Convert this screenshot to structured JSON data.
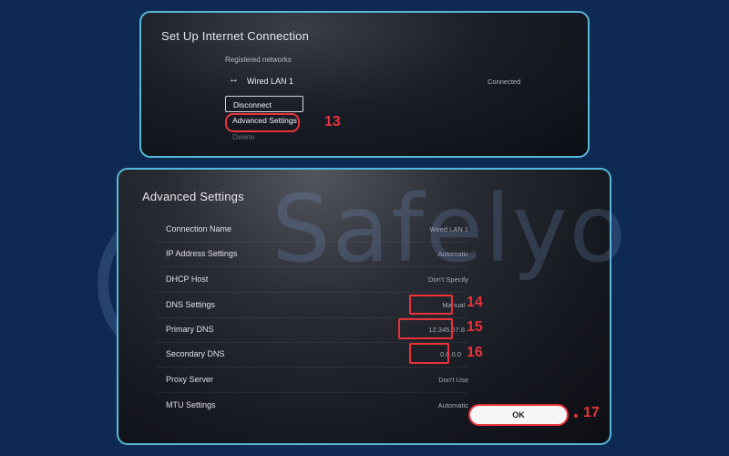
{
  "top_panel": {
    "title": "Set Up Internet Connection",
    "section_label": "Registered networks",
    "network": {
      "name": "Wired LAN 1",
      "status": "Connected"
    },
    "menu": [
      {
        "label": "Disconnect"
      },
      {
        "label": "Advanced Settings"
      },
      {
        "label": "Delete"
      }
    ],
    "step": "13"
  },
  "bottom_panel": {
    "title": "Advanced Settings",
    "rows": [
      {
        "label": "Connection Name",
        "value": "Wired LAN 1"
      },
      {
        "label": "IP Address Settings",
        "value": "Automatic"
      },
      {
        "label": "DHCP Host",
        "value": "Don't Specify"
      },
      {
        "label": "DNS Settings",
        "value": "Manual"
      },
      {
        "label": "Primary DNS",
        "value": "12.345.67.8"
      },
      {
        "label": "Secondary DNS",
        "value": "0.0.0.0"
      },
      {
        "label": "Proxy Server",
        "value": "Don't Use"
      },
      {
        "label": "MTU Settings",
        "value": "Automatic"
      }
    ],
    "ok_label": "OK",
    "steps": {
      "dns_settings": "14",
      "primary_dns": "15",
      "secondary_dns": "16",
      "ok": "17"
    }
  },
  "watermark": {
    "text": "Safelyo"
  },
  "colors": {
    "background": "#0f2a52",
    "panel_border": "#56b8d8",
    "highlight": "#e8333a"
  }
}
